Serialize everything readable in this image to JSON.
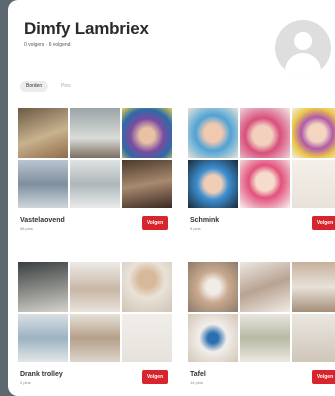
{
  "profile": {
    "name": "Dimfy Lambriex",
    "stats": "0 volgers · 6 volgend"
  },
  "tabs": [
    {
      "label": "Borden",
      "active": true
    },
    {
      "label": "Pins",
      "active": false
    }
  ],
  "boards": [
    {
      "title": "Vastelaovend",
      "count": "36 pins",
      "follow_label": "Volgen"
    },
    {
      "title": "Schmink",
      "count": "9 pins",
      "follow_label": "Volgen"
    },
    {
      "title": "Drank trolley",
      "count": "2 pins",
      "follow_label": "Volgen"
    },
    {
      "title": "Tafel",
      "count": "14 pins",
      "follow_label": "Volgen"
    }
  ],
  "colors": {
    "follow_button": "#d7242d",
    "background": "#5c6870",
    "page": "#ffffff"
  }
}
